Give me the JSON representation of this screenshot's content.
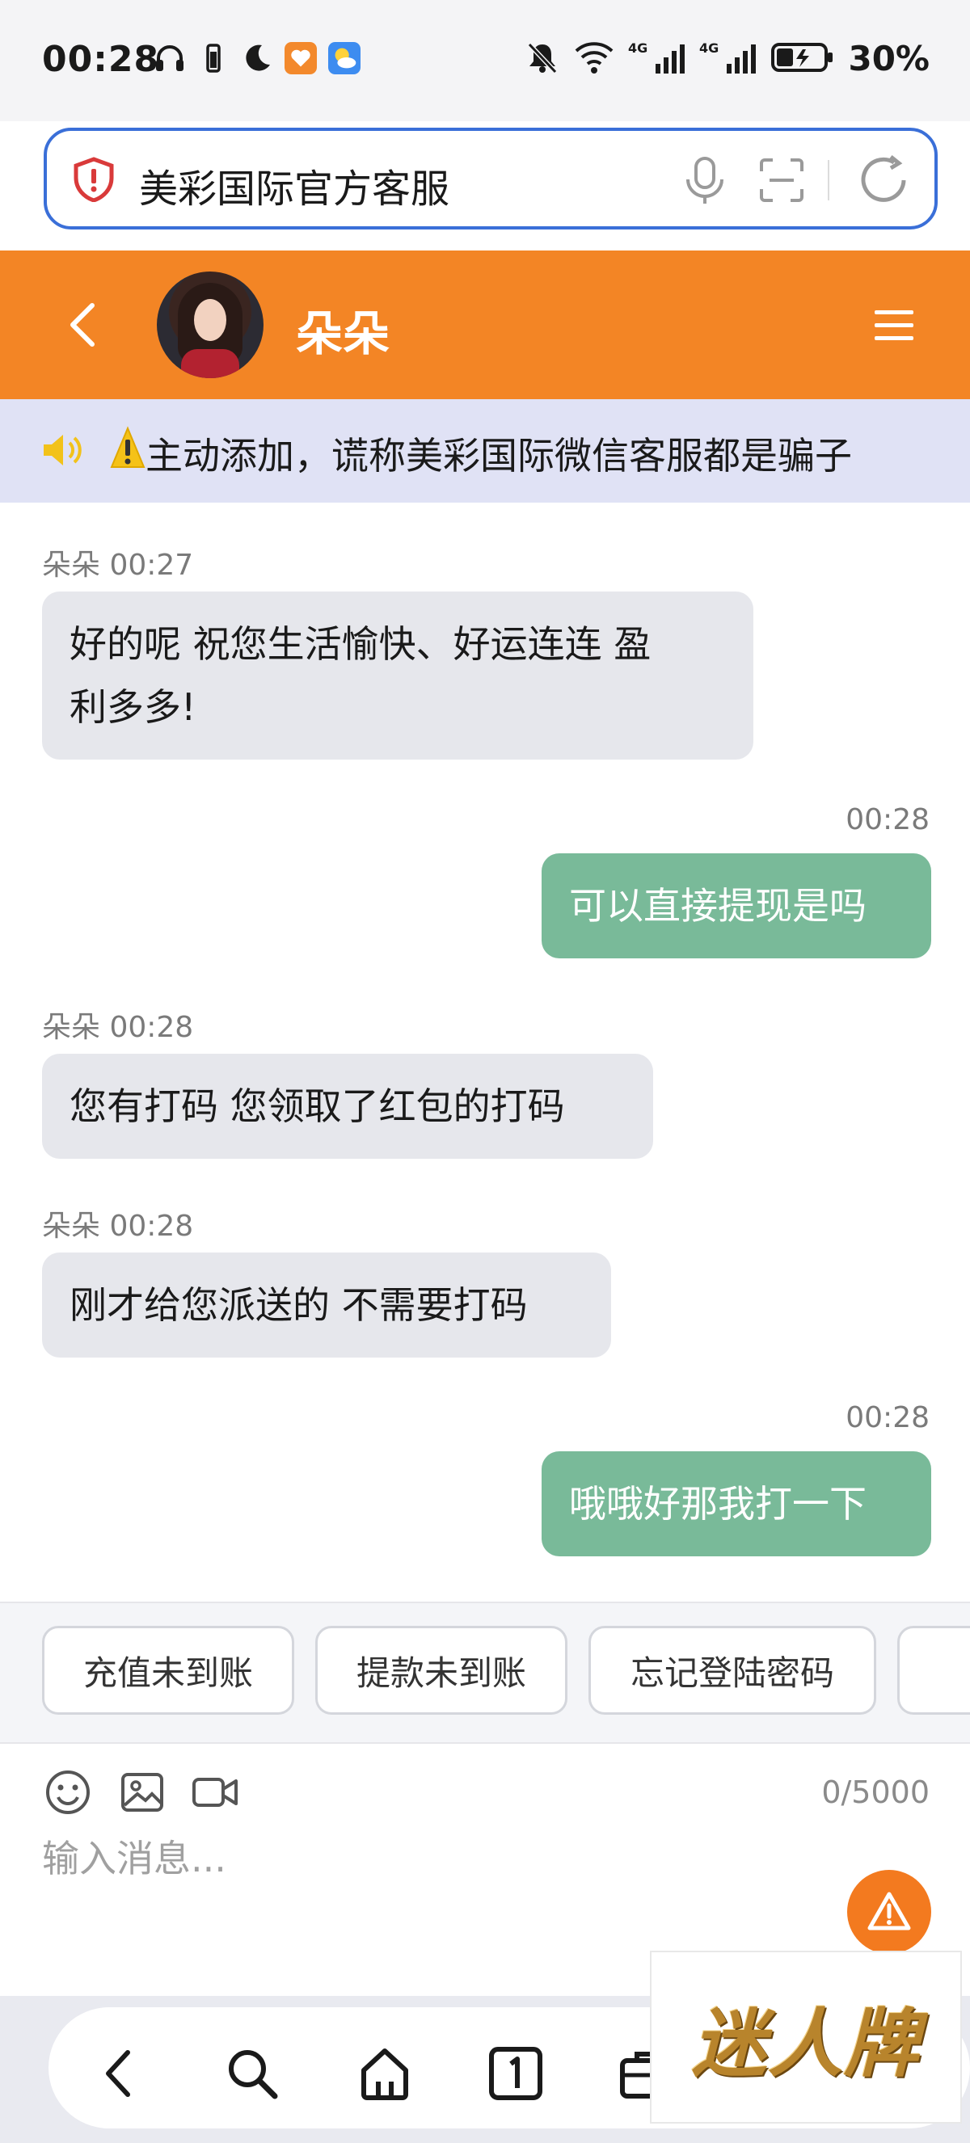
{
  "status_bar": {
    "time": "00:28",
    "battery": "30%",
    "net1": "4G",
    "net2": "4G"
  },
  "url_bar": {
    "text": "美彩国际官方客服"
  },
  "header": {
    "name": "朵朵"
  },
  "notice": {
    "text": "主动添加，谎称美彩国际微信客服都是骗子"
  },
  "messages": [
    {
      "from": "agent",
      "meta": "朵朵 00:27",
      "lines": [
        "好的呢 祝您生活愉快、好运连连 盈",
        "利多多!"
      ]
    },
    {
      "from": "user",
      "meta": "00:28",
      "lines": [
        "可以直接提现是吗"
      ]
    },
    {
      "from": "agent",
      "meta": "朵朵 00:28",
      "lines": [
        "您有打码 您领取了红包的打码"
      ]
    },
    {
      "from": "agent",
      "meta": "朵朵 00:28",
      "lines": [
        "刚才给您派送的 不需要打码"
      ]
    },
    {
      "from": "user",
      "meta": "00:28",
      "lines": [
        "哦哦好那我打一下"
      ]
    }
  ],
  "quick_replies": [
    "充值未到账",
    "提款未到账",
    "忘记登陆密码"
  ],
  "composer": {
    "placeholder": "输入消息...",
    "counter": "0/5000"
  },
  "watermark": "迷人牌",
  "colors": {
    "accent": "#f38525",
    "user_bubble": "#79ba99",
    "agent_bubble": "#e6e7ec",
    "notice_bg": "#e0e2f5",
    "url_border": "#3a6fd8"
  },
  "icons": {
    "status": [
      "headphones-icon",
      "vibrate-icon",
      "moon-icon",
      "app-heart-icon",
      "weather-icon",
      "mute-icon",
      "wifi-icon",
      "signal-icon",
      "battery-icon"
    ],
    "url": [
      "shield-icon",
      "mic-icon",
      "scan-icon",
      "refresh-icon"
    ],
    "header": [
      "back-icon",
      "menu-icon"
    ],
    "notice": [
      "speaker-icon",
      "warning-icon"
    ],
    "composer": [
      "emoji-icon",
      "image-icon",
      "video-icon",
      "alert-icon"
    ],
    "nav": [
      "back-icon",
      "search-icon",
      "home-icon",
      "tabs-icon",
      "briefcase-icon"
    ]
  }
}
